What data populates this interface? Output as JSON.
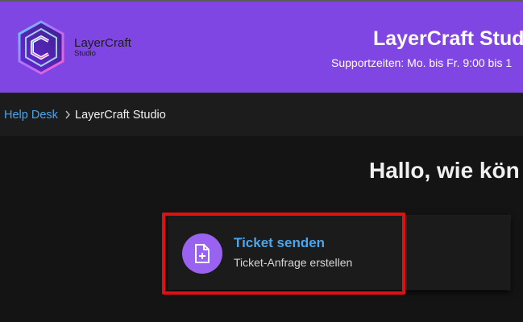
{
  "header": {
    "logo": {
      "name_line1": "LayerCraft",
      "name_line2": "Studio",
      "icon": "layercraft-logo-icon"
    },
    "title": "LayerCraft Studio",
    "support_hours": "Supportzeiten: Mo. bis Fr. 9:00 bis 1"
  },
  "breadcrumb": {
    "home_label": "Help Desk",
    "separator_icon": "chevron-right-icon",
    "current_label": "LayerCraft Studio"
  },
  "main": {
    "greeting": "Hallo, wie kön",
    "cards": [
      {
        "title": "Ticket senden",
        "description": "Ticket-Anfrage erstellen",
        "icon": "file-plus-icon"
      }
    ]
  },
  "colors": {
    "header_bg": "#8046e3",
    "page_bg": "#141414",
    "link_blue": "#49a6ee",
    "icon_circle": "#9a62f0",
    "highlight_red": "#e01010"
  }
}
